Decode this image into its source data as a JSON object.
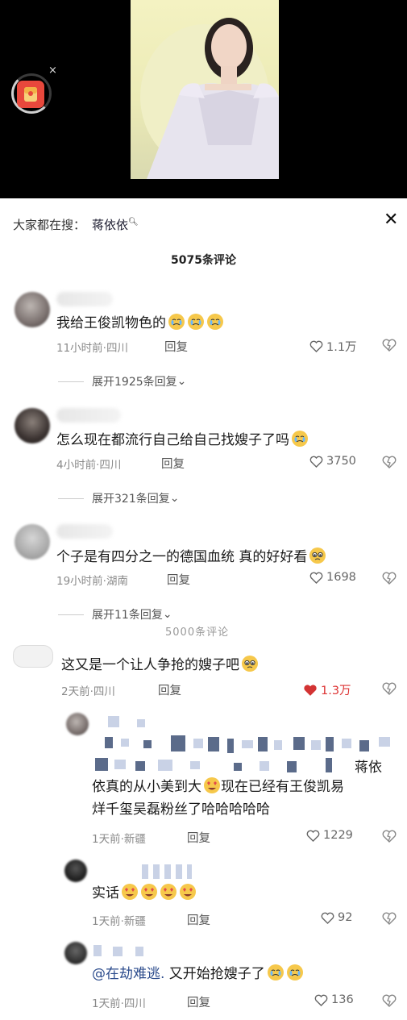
{
  "search": {
    "prefix": "大家都在搜：",
    "keyword": "蒋依依"
  },
  "comments_count": "5075条评论",
  "ghost_overlap": "5000条评论",
  "comments": [
    {
      "text": "我给王俊凯物色的",
      "time": "11小时前·四川",
      "reply": "回复",
      "likes": "1.1万",
      "expand": "展开1925条回复"
    },
    {
      "text": "怎么现在都流行自己给自己找嫂子了吗",
      "time": "4小时前·四川",
      "reply": "回复",
      "likes": "3750",
      "expand": "展开321条回复"
    },
    {
      "text": "个子是有四分之一的德国血统 真的好好看",
      "time": "19小时前·湖南",
      "reply": "回复",
      "likes": "1698",
      "expand": "展开11条回复"
    },
    {
      "text": "这又是一个让人争抢的嫂子吧",
      "time": "2天前·四川",
      "reply": "回复",
      "likes": "1.3万",
      "liked": true
    }
  ],
  "replies": [
    {
      "text_line1": "蒋依",
      "text_line2": "依真的从小美到大",
      "text_line2b": "现在已经有王俊凯易",
      "text_line3": "烊千玺吴磊粉丝了哈哈哈哈哈",
      "time": "1天前·新疆",
      "reply": "回复",
      "likes": "1229"
    },
    {
      "text": "实话",
      "time": "1天前·新疆",
      "reply": "回复",
      "likes": "92"
    },
    {
      "mention": "@在劫难逃.",
      "text": " 又开始抢嫂子了",
      "time": "1天前·四川",
      "reply": "回复",
      "likes": "136"
    }
  ],
  "colors": {
    "accent_red": "#e8483c",
    "liked_red": "#d33333",
    "mention_blue": "#2b4b8c"
  }
}
